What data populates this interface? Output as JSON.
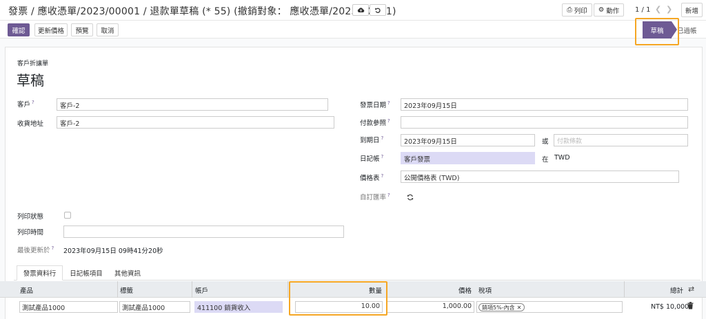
{
  "breadcrumb": "發票 / 應收憑單/2023/00001 / 退款單草稿 (* 55) (撤銷對象： 應收憑單/2023/00001)",
  "toolbar": {
    "print": "列印",
    "action": "動作",
    "pager": "1 / 1",
    "new": "新增"
  },
  "actions": {
    "confirm": "確認",
    "update_prices": "更新價格",
    "preview": "預覽",
    "cancel": "取消"
  },
  "status": {
    "current": "草稿",
    "next": "已過帳"
  },
  "form": {
    "doc_type": "客戶折讓單",
    "state_title": "草稿",
    "customer_label": "客戶",
    "customer": "客戶-2",
    "delivery_label": "收貨地址",
    "delivery": "客戶-2",
    "invoice_date_label": "發票日期",
    "invoice_date": "2023年09月15日",
    "payment_ref_label": "付款參照",
    "payment_ref": "",
    "due_date_label": "到期日",
    "due_date": "2023年09月15日",
    "or_label": "或",
    "payment_terms_placeholder": "付款條款",
    "journal_label": "日記帳",
    "journal": "客戶發票",
    "in_label": "在",
    "currency": "TWD",
    "pricelist_label": "價格表",
    "pricelist": "公開價格表 (TWD)",
    "custom_rate_label": "自訂匯率",
    "print_status_label": "列印狀態",
    "print_time_label": "列印時間",
    "print_time": "",
    "last_updated_label": "最後更新於",
    "last_updated": "2023年09月15日 09時41分20秒"
  },
  "tabs": [
    "發票資料行",
    "日記帳項目",
    "其他資訊"
  ],
  "table": {
    "headers": {
      "product": "產品",
      "label": "標籤",
      "account": "帳戶",
      "qty": "數量",
      "price": "價格",
      "tax": "稅項",
      "total": "總計"
    },
    "row": {
      "product": "測試產品1000",
      "label": "測試產品1000",
      "account": "411100 銷貨收入",
      "qty": "10.00",
      "price": "1,000.00",
      "tax": "銷項5%-內含",
      "total": "NT$ 10,000"
    }
  },
  "colors": {
    "primary": "#6e5a94",
    "highlight": "#f5a623",
    "tinted": "#dcdaf5"
  }
}
